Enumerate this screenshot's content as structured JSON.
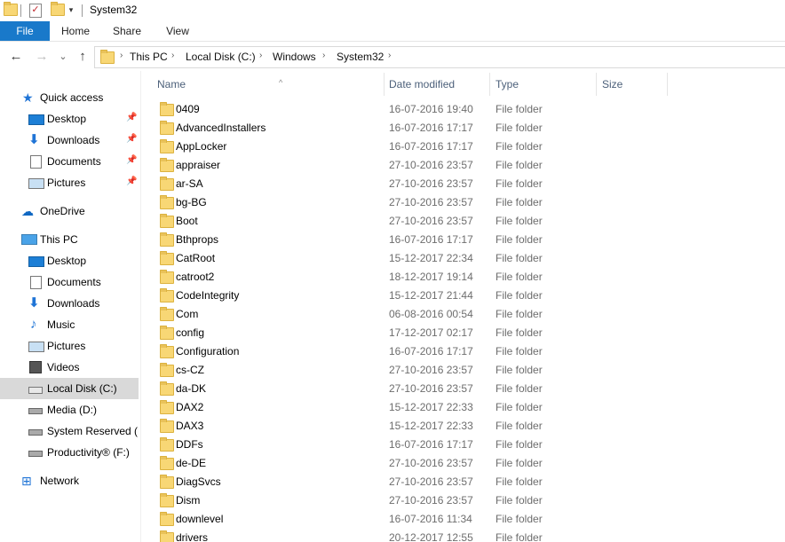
{
  "window": {
    "title": "System32"
  },
  "quick_toolbar": {
    "icons": [
      "folder-icon",
      "properties-check-icon",
      "new-folder-icon",
      "customize-dropdown-icon"
    ]
  },
  "ribbon": {
    "tabs": [
      "File",
      "Home",
      "Share",
      "View"
    ]
  },
  "nav": {
    "back": "←",
    "forward": "→",
    "recent": "⌄",
    "up": "↑"
  },
  "address": {
    "crumbs": [
      "This PC",
      "Local Disk (C:)",
      "Windows",
      "System32"
    ],
    "separator": "›"
  },
  "sidebar": {
    "items": [
      {
        "label": "Quick access",
        "icon": "quick-access-star-icon",
        "pinned": false
      },
      {
        "label": "Desktop",
        "icon": "desktop-icon",
        "pinned": true
      },
      {
        "label": "Downloads",
        "icon": "downloads-icon",
        "pinned": true
      },
      {
        "label": "Documents",
        "icon": "documents-icon",
        "pinned": true
      },
      {
        "label": "Pictures",
        "icon": "pictures-icon",
        "pinned": true
      },
      {
        "label": "OneDrive",
        "icon": "onedrive-cloud-icon",
        "pinned": false
      },
      {
        "label": "This PC",
        "icon": "this-pc-icon",
        "pinned": false
      },
      {
        "label": "Desktop",
        "icon": "desktop-icon",
        "pinned": false
      },
      {
        "label": "Documents",
        "icon": "documents-icon",
        "pinned": false
      },
      {
        "label": "Downloads",
        "icon": "downloads-icon",
        "pinned": false
      },
      {
        "label": "Music",
        "icon": "music-icon",
        "pinned": false
      },
      {
        "label": "Pictures",
        "icon": "pictures-icon",
        "pinned": false
      },
      {
        "label": "Videos",
        "icon": "videos-icon",
        "pinned": false
      },
      {
        "label": "Local Disk (C:)",
        "icon": "local-disk-icon",
        "pinned": false,
        "selected": true
      },
      {
        "label": "Media (D:)",
        "icon": "drive-icon",
        "pinned": false
      },
      {
        "label": "System Reserved (E:",
        "icon": "drive-icon",
        "pinned": false
      },
      {
        "label": "Productivity® (F:)",
        "icon": "drive-icon",
        "pinned": false
      },
      {
        "label": "Network",
        "icon": "network-icon",
        "pinned": false
      }
    ],
    "pin_glyph": "📌"
  },
  "filelist": {
    "columns": [
      "Name",
      "Date modified",
      "Type",
      "Size"
    ],
    "sort_arrow": "^",
    "rows": [
      {
        "name": "0409",
        "date": "16-07-2016 19:40",
        "type": "File folder"
      },
      {
        "name": "AdvancedInstallers",
        "date": "16-07-2016 17:17",
        "type": "File folder"
      },
      {
        "name": "AppLocker",
        "date": "16-07-2016 17:17",
        "type": "File folder"
      },
      {
        "name": "appraiser",
        "date": "27-10-2016 23:57",
        "type": "File folder"
      },
      {
        "name": "ar-SA",
        "date": "27-10-2016 23:57",
        "type": "File folder"
      },
      {
        "name": "bg-BG",
        "date": "27-10-2016 23:57",
        "type": "File folder"
      },
      {
        "name": "Boot",
        "date": "27-10-2016 23:57",
        "type": "File folder"
      },
      {
        "name": "Bthprops",
        "date": "16-07-2016 17:17",
        "type": "File folder"
      },
      {
        "name": "CatRoot",
        "date": "15-12-2017 22:34",
        "type": "File folder"
      },
      {
        "name": "catroot2",
        "date": "18-12-2017 19:14",
        "type": "File folder"
      },
      {
        "name": "CodeIntegrity",
        "date": "15-12-2017 21:44",
        "type": "File folder"
      },
      {
        "name": "Com",
        "date": "06-08-2016 00:54",
        "type": "File folder"
      },
      {
        "name": "config",
        "date": "17-12-2017 02:17",
        "type": "File folder"
      },
      {
        "name": "Configuration",
        "date": "16-07-2016 17:17",
        "type": "File folder"
      },
      {
        "name": "cs-CZ",
        "date": "27-10-2016 23:57",
        "type": "File folder"
      },
      {
        "name": "da-DK",
        "date": "27-10-2016 23:57",
        "type": "File folder"
      },
      {
        "name": "DAX2",
        "date": "15-12-2017 22:33",
        "type": "File folder"
      },
      {
        "name": "DAX3",
        "date": "15-12-2017 22:33",
        "type": "File folder"
      },
      {
        "name": "DDFs",
        "date": "16-07-2016 17:17",
        "type": "File folder"
      },
      {
        "name": "de-DE",
        "date": "27-10-2016 23:57",
        "type": "File folder"
      },
      {
        "name": "DiagSvcs",
        "date": "27-10-2016 23:57",
        "type": "File folder"
      },
      {
        "name": "Dism",
        "date": "27-10-2016 23:57",
        "type": "File folder"
      },
      {
        "name": "downlevel",
        "date": "16-07-2016 11:34",
        "type": "File folder"
      },
      {
        "name": "drivers",
        "date": "20-12-2017 12:55",
        "type": "File folder"
      }
    ]
  },
  "colors": {
    "accent": "#1979ca",
    "selected": "#d9d9d9",
    "folder": "#f8d775",
    "header_text": "#4c607a",
    "muted_text": "#6d6d6d"
  }
}
